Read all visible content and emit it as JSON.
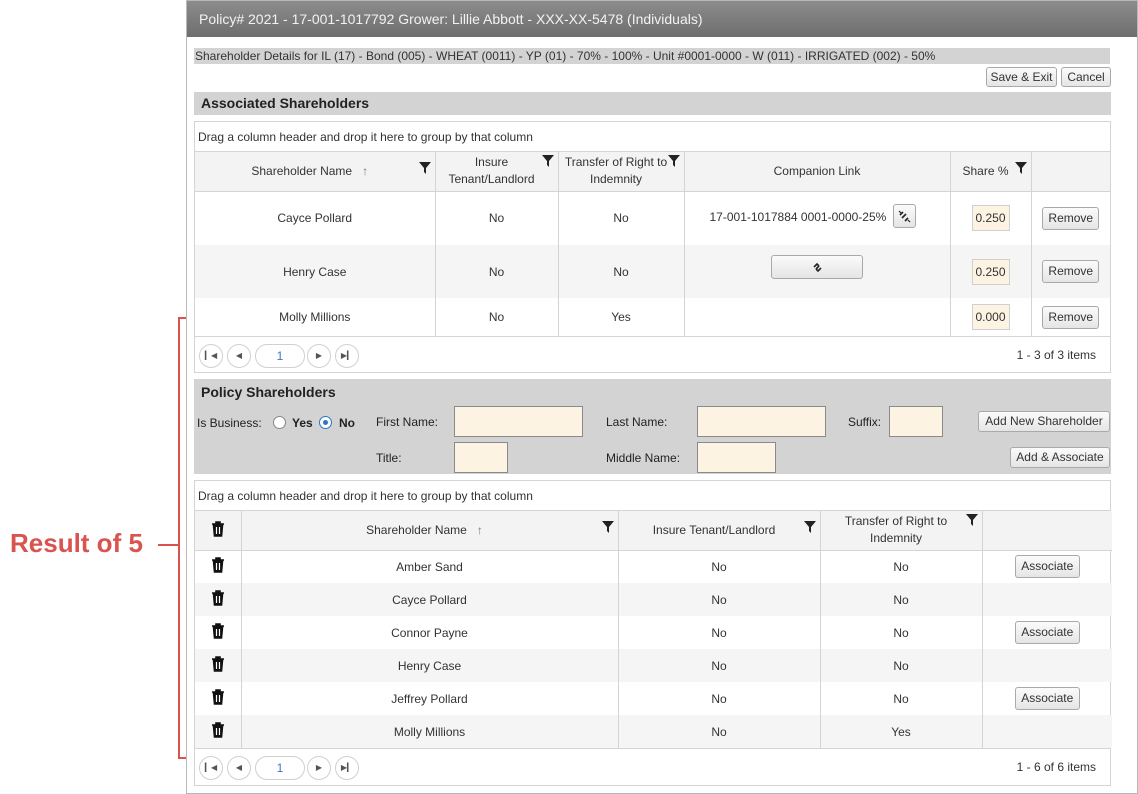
{
  "window": {
    "title": "Policy# 2021 - 17-001-1017792 Grower: Lillie Abbott - XXX-XX-5478 (Individuals)",
    "breadcrumb": "Shareholder Details for IL (17) - Bond (005) - WHEAT (0011) - YP (01) - 70% - 100% - Unit #0001-0000 - W (011) - IRRIGATED (002) - 50%"
  },
  "toolbar": {
    "save_exit": "Save & Exit",
    "cancel": "Cancel"
  },
  "annotation": {
    "text": "Result of 5",
    "color": "#d9534f"
  },
  "associated": {
    "title": "Associated Shareholders",
    "group_hint": "Drag a column header and drop it here to group by that column",
    "columns": {
      "name": "Shareholder Name",
      "insure": "Insure Tenant/Landlord",
      "transfer": "Transfer of Right to Indemnity",
      "companion": "Companion Link",
      "share": "Share %"
    },
    "rows": [
      {
        "name": "Cayce Pollard",
        "insure": "No",
        "transfer": "No",
        "companion": "17-001-1017884  0001-0000-25%",
        "share": "0.250",
        "action": "Remove"
      },
      {
        "name": "Henry Case",
        "insure": "No",
        "transfer": "No",
        "companion": "",
        "share": "0.250",
        "action": "Remove"
      },
      {
        "name": "Molly Millions",
        "insure": "No",
        "transfer": "Yes",
        "companion": "",
        "share": "0.000",
        "action": "Remove"
      }
    ],
    "pager": {
      "page": "1",
      "info": "1 - 3 of 3 items"
    }
  },
  "policy": {
    "title": "Policy Shareholders",
    "is_business_label": "Is Business:",
    "yes_label": "Yes",
    "no_label": "No",
    "first_name_label": "First Name:",
    "last_name_label": "Last Name:",
    "suffix_label": "Suffix:",
    "title_label": "Title:",
    "middle_name_label": "Middle Name:",
    "add_new_button": "Add New Shareholder",
    "add_associate_button": "Add & Associate",
    "group_hint": "Drag a column header and drop it here to group by that column",
    "columns": {
      "name": "Shareholder Name",
      "insure": "Insure Tenant/Landlord",
      "transfer": "Transfer of Right to Indemnity"
    },
    "rows": [
      {
        "name": "Amber Sand",
        "insure": "No",
        "transfer": "No",
        "action": "Associate"
      },
      {
        "name": "Cayce Pollard",
        "insure": "No",
        "transfer": "No",
        "action": ""
      },
      {
        "name": "Connor Payne",
        "insure": "No",
        "transfer": "No",
        "action": "Associate"
      },
      {
        "name": "Henry Case",
        "insure": "No",
        "transfer": "No",
        "action": ""
      },
      {
        "name": "Jeffrey Pollard",
        "insure": "No",
        "transfer": "No",
        "action": "Associate"
      },
      {
        "name": "Molly Millions",
        "insure": "No",
        "transfer": "Yes",
        "action": ""
      }
    ],
    "pager": {
      "page": "1",
      "info": "1 - 6 of 6 items"
    }
  }
}
